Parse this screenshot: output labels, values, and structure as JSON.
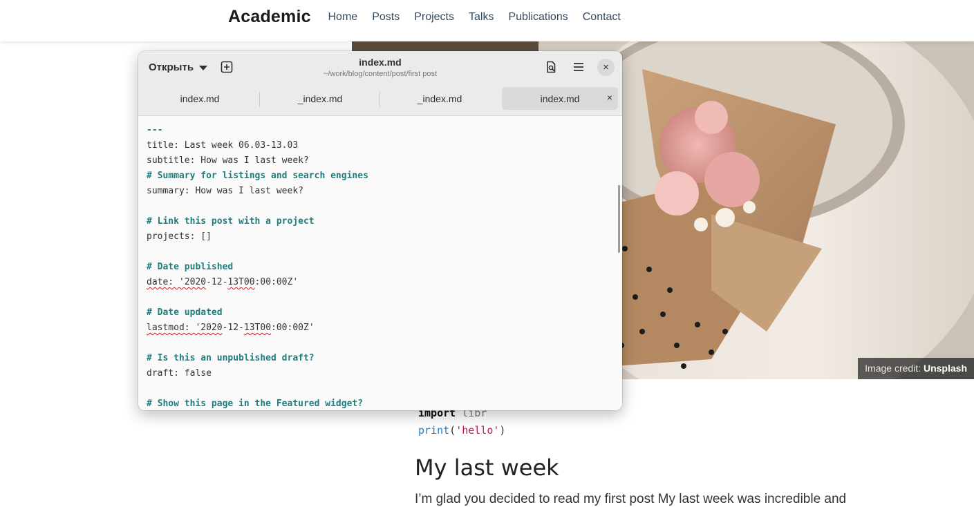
{
  "site": {
    "brand": "Academic",
    "nav": [
      "Home",
      "Posts",
      "Projects",
      "Talks",
      "Publications",
      "Contact"
    ]
  },
  "hero": {
    "credit_prefix": "Image credit:",
    "credit_source": "Unsplash"
  },
  "page": {
    "code": {
      "line1_kw": "import",
      "line1_mod": "libr",
      "line2_fn": "print",
      "line2_open": "(",
      "line2_str": "'hello'",
      "line2_close": ")"
    },
    "heading": "My last week",
    "paragraph": "I’m glad you decided to read my first post My last week was incredible and"
  },
  "editor": {
    "open_label": "Открыть",
    "title": "index.md",
    "path": "~/work/blog/content/post/first post",
    "close_glyph": "×",
    "tabs": [
      {
        "label": "index.md"
      },
      {
        "label": "_index.md"
      },
      {
        "label": "_index.md"
      },
      {
        "label": "index.md"
      }
    ],
    "lines": [
      {
        "text": "---",
        "type": "sep"
      },
      {
        "text": "title: Last week 06.03-13.03",
        "type": "plain"
      },
      {
        "text": "subtitle: How was I last week?",
        "type": "plain"
      },
      {
        "text": "# Summary for listings and search engines",
        "type": "comment"
      },
      {
        "text": "summary: How was I last week?",
        "type": "plain"
      },
      {
        "text": "",
        "type": "plain"
      },
      {
        "text": "# Link this post with a project",
        "type": "comment"
      },
      {
        "text": "projects: []",
        "type": "plain"
      },
      {
        "text": "",
        "type": "plain"
      },
      {
        "text": "# Date published",
        "type": "comment"
      },
      {
        "text": "date: '2020-12-13T00:00:00Z'",
        "type": "date",
        "a": "date: '2020",
        "b": "-12-",
        "c": "13T00",
        "d": ":00:00Z'"
      },
      {
        "text": "",
        "type": "plain"
      },
      {
        "text": "# Date updated",
        "type": "comment"
      },
      {
        "text": "lastmod: '2020-12-13T00:00:00Z'",
        "type": "date",
        "a": "lastmod: '2020",
        "b": "-12-",
        "c": "13T00",
        "d": ":00:00Z'"
      },
      {
        "text": "",
        "type": "plain"
      },
      {
        "text": "# Is this an unpublished draft?",
        "type": "comment"
      },
      {
        "text": "draft: false",
        "type": "plain"
      },
      {
        "text": "",
        "type": "plain"
      },
      {
        "text": "# Show this page in the Featured widget?",
        "type": "comment"
      }
    ]
  }
}
